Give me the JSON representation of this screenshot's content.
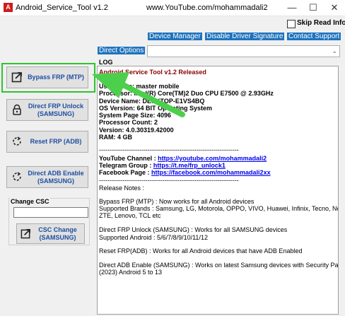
{
  "window": {
    "title": "Android_Service_Tool v1.2",
    "url_title": "www.YouTube.com/mohammadali2",
    "icon_text": "A",
    "controls": {
      "minimize": "—",
      "maximize": "☐",
      "close": "✕"
    }
  },
  "options": {
    "skip_read_info": "Skip Read Info.",
    "skip_checked": false
  },
  "top_links": {
    "device_manager": "Device Manager",
    "disable_driver_signature": "Disable Driver Signature",
    "contact_support": "Contact Support"
  },
  "direct_options": {
    "label": "Direct Options",
    "value": "",
    "chevron": "⌄"
  },
  "sidebar": {
    "bypass_frp_mtp": "Bypass FRP (MTP)",
    "direct_frp_unlock": "Direct FRP Unlock (SAMSUNG)",
    "reset_frp_adb": "Reset FRP (ADB)",
    "direct_adb_enable": "Direct ADB Enable (SAMSUNG)"
  },
  "csc": {
    "group_label": "Change CSC",
    "input_value": "",
    "button_label": "CSC Change (SAMSUNG)"
  },
  "log": {
    "label": "LOG",
    "release_line": "Android Service Tool v1.2 Released",
    "user_name": "User Name: master mobile",
    "processor": "Processor: Intel(R) Core(TM)2 Duo CPU E7500 @ 2.93GHz",
    "device_name": "Device Name: DESKTOP-E1VS4BQ",
    "os_version": "OS Version: 64 BIT Operating System",
    "page_size": "System Page Size: 4096",
    "processor_count": "Processor Count: 2",
    "version": "Version: 4.0.30319.42000",
    "ram": "RAM: 4 GB",
    "separator1": "------------------------------------------------------------------",
    "youtube_label": "YouTube Channel : ",
    "youtube_link": "https://youtube.com/mohammadali2",
    "telegram_label": "Telegram Group : ",
    "telegram_link": "https://t.me/frp_unlock1",
    "facebook_label": "Facebook Page : ",
    "facebook_link": "https://facebook.com/mohammadali2xx",
    "separator2": "------------------------------------------------------------------",
    "release_notes": "Release Notes :",
    "note1_a": "Bypass FRP (MTP) : Now works for all Android devices",
    "note1_b": "Supported Brands : Samsung, LG, Motorola, OPPO, VIVO, Huawei, Infinix, Tecno, Nokia,",
    "note1_c": "ZTE, Lenovo, TCL etc",
    "note2_a": "Direct FRP Unlock (SAMSUNG) : Works for all SAMSUNG devices",
    "note2_b": "Supported Android : 5/6/7/8/9/10/11/12",
    "note3": "Reset FRP(ADB) : Works for all Android devices that have ADB Enabled",
    "note4_a": "Direct ADB Enable (SAMSUNG) : Works on latest Samsung devices with Security Patch",
    "note4_b": "(2023) Android 5 to 13"
  },
  "colors": {
    "accent": "#1e73be",
    "link": "#0000ee",
    "highlight": "#2ec42e",
    "arrow": "#4cd04c"
  }
}
